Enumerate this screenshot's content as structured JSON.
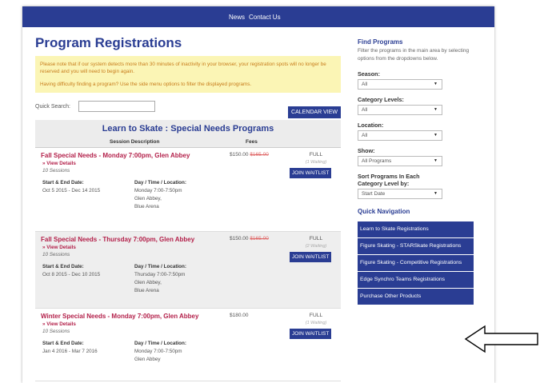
{
  "topnav": {
    "news": "News",
    "contact": "Contact Us"
  },
  "page_title": "Program Registrations",
  "notice": {
    "line1": "Please note that if our system detects more than 30 minutes of inactivity in your browser, your registration spots will no longer be reserved and you will need to begin again.",
    "line2": "Having difficulty finding a program? Use the side menu options to filter the displayed programs."
  },
  "search": {
    "label": "Quick Search:",
    "value": ""
  },
  "calendar_button": "CALENDAR VIEW",
  "table": {
    "title": "Learn to Skate : Special Needs Programs",
    "col_session": "Session Description",
    "col_fees": "Fees"
  },
  "programs": [
    {
      "title": "Fall Special Needs - Monday 7:00pm, Glen Abbey",
      "details": "» View Details",
      "sessions": "10 Sessions",
      "date_label": "Start & End Date:",
      "date": "Oct 5 2015 - Dec 14 2015",
      "dtl_label": "Day / Time / Location:",
      "day": "Monday 7:00-7:50pm",
      "loc1": "Glen Abbey,",
      "loc2": "Blue Arena",
      "fee": "$150.00",
      "fee_old": "$165.00",
      "status": "FULL",
      "waiting": "(1 Waiting)",
      "join": "JOIN WAITLIST"
    },
    {
      "title": "Fall Special Needs - Thursday 7:00pm, Glen Abbey",
      "details": "» View Details",
      "sessions": "10 Sessions",
      "date_label": "Start & End Date:",
      "date": "Oct 8 2015 - Dec 10 2015",
      "dtl_label": "Day / Time / Location:",
      "day": "Thursday 7:00-7:50pm",
      "loc1": "Glen Abbey,",
      "loc2": "Blue Arena",
      "fee": "$150.00",
      "fee_old": "$165.00",
      "status": "FULL",
      "waiting": "(2 Waiting)",
      "join": "JOIN WAITLIST"
    },
    {
      "title": "Winter Special Needs - Monday 7:00pm, Glen Abbey",
      "details": "» View Details",
      "sessions": "10 Sessions",
      "date_label": "Start & End Date:",
      "date": "Jan 4 2016 - Mar 7 2016",
      "dtl_label": "Day / Time / Location:",
      "day": "Monday 7:00-7:50pm",
      "loc1": "Glen Abbey",
      "loc2": "",
      "fee": "$180.00",
      "fee_old": "",
      "status": "FULL",
      "waiting": "(1 Waiting)",
      "join": "JOIN WAITLIST"
    }
  ],
  "sidebar": {
    "title": "Find Programs",
    "desc": "Filter the programs in the main area by selecting options from the dropdowns below.",
    "season_label": "Season:",
    "season": "All",
    "category_label": "Category Levels:",
    "category": "All",
    "location_label": "Location:",
    "location": "All",
    "show_label": "Show:",
    "show": "All Programs",
    "sort_label": "Sort Programs In Each Category Level by:",
    "sort": "Start Date",
    "quick_nav_title": "Quick Navigation",
    "quick_nav": [
      "Learn to Skate Registrations",
      "Figure Skating - STARSkate Registrations",
      "Figure Skating - Competitive Registrations",
      "Edge Synchro Teams Registrations",
      "Purchase Other Products"
    ]
  }
}
